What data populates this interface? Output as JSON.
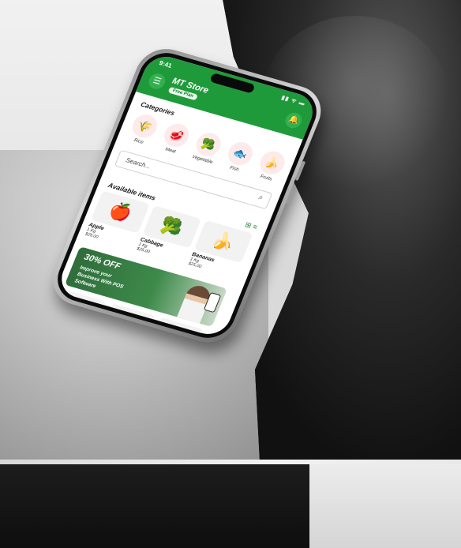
{
  "status": {
    "time": "9:41",
    "icons": "▮▮ ᯤ ▬"
  },
  "header": {
    "store_name": "MT Store",
    "plan": "Free Plan",
    "menu_icon": "☰",
    "bell_icon": "🔔"
  },
  "categories": {
    "title": "Categories",
    "items": [
      {
        "label": "Rice",
        "icon": "🌾"
      },
      {
        "label": "Meat",
        "icon": "🥩"
      },
      {
        "label": "Vegetable",
        "icon": "🥦"
      },
      {
        "label": "Fish",
        "icon": "🐟"
      },
      {
        "label": "Fruits",
        "icon": "🍌"
      }
    ]
  },
  "search": {
    "placeholder": "Search...",
    "icon": "⌕"
  },
  "available": {
    "title": "Available items",
    "view_icons": "⊞ ≡",
    "items": [
      {
        "name": "Apple",
        "qty": "1 Kg",
        "price": "$25.00",
        "icon": "🍎"
      },
      {
        "name": "Cabbage",
        "qty": "1 Kg",
        "price": "$25.00",
        "icon": "🥦"
      },
      {
        "name": "Bananas",
        "qty": "1 Kg",
        "price": "$25.00",
        "icon": "🍌"
      }
    ]
  },
  "banner": {
    "discount": "30% OFF",
    "line1": "Improve your",
    "line2": "Business With POS",
    "line3": "Software"
  },
  "bottom_items": [
    {
      "icon": "🌾"
    },
    {
      "icon": "🍊"
    },
    {
      "icon": "🥩"
    }
  ],
  "colors": {
    "brand": "#1f9a3a"
  }
}
